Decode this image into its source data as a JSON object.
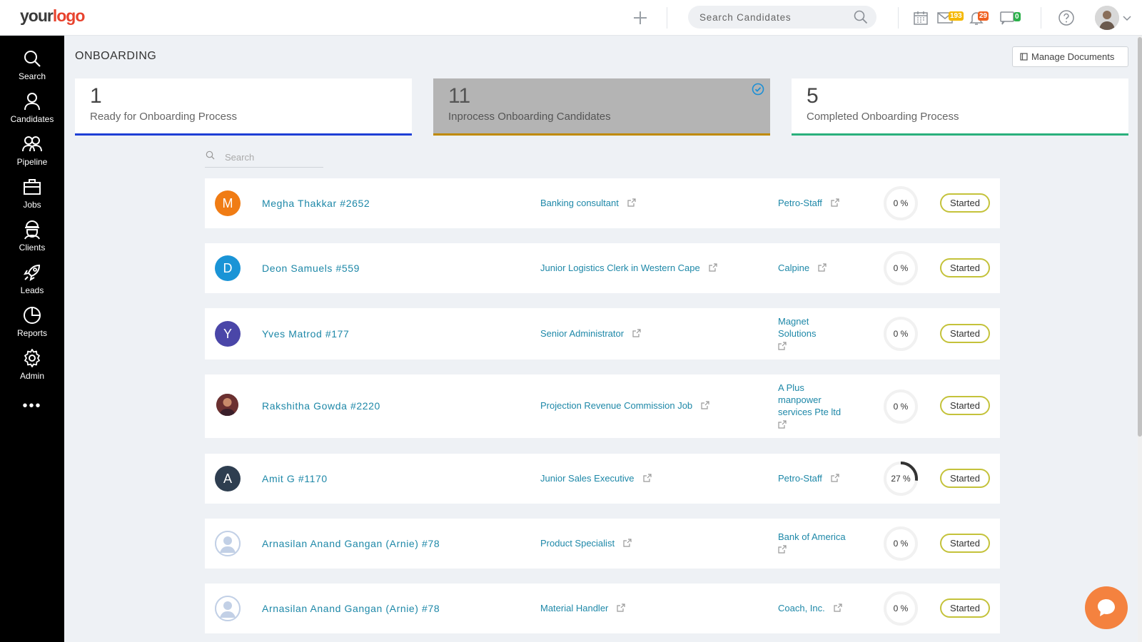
{
  "logo": {
    "part1": "your",
    "part2": "logo"
  },
  "topbar": {
    "search_placeholder": "Search Candidates",
    "mail_count": "193",
    "notification_count": "29",
    "chat_count": "0"
  },
  "sidebar": {
    "items": [
      {
        "label": "Search",
        "icon": "search-icon"
      },
      {
        "label": "Candidates",
        "icon": "user-icon"
      },
      {
        "label": "Pipeline",
        "icon": "users-icon"
      },
      {
        "label": "Jobs",
        "icon": "briefcase-icon"
      },
      {
        "label": "Clients",
        "icon": "client-icon"
      },
      {
        "label": "Leads",
        "icon": "rocket-icon"
      },
      {
        "label": "Reports",
        "icon": "pie-chart-icon"
      },
      {
        "label": "Admin",
        "icon": "gear-icon"
      }
    ],
    "more": "•••"
  },
  "page": {
    "title": "ONBOARDING",
    "manage_documents": "Manage Documents"
  },
  "stats": [
    {
      "count": "1",
      "label": "Ready for Onboarding Process",
      "color": "#1e3fd6"
    },
    {
      "count": "11",
      "label": "Inprocess Onboarding Candidates",
      "color": "#c08a00"
    },
    {
      "count": "5",
      "label": "Completed Onboarding Process",
      "color": "#2ab07c"
    }
  ],
  "list": {
    "search_placeholder": "Search",
    "rows": [
      {
        "initial": "M",
        "avatar_color": "#f07c14",
        "name": "Megha Thakkar #2652",
        "job": "Banking consultant",
        "client": "Petro-Staff",
        "progress": 0,
        "progress_label": "0 %",
        "status": "Started"
      },
      {
        "initial": "D",
        "avatar_color": "#1a94d6",
        "name": "Deon Samuels #559",
        "job": "Junior Logistics Clerk in Western Cape",
        "client": "Calpine",
        "progress": 0,
        "progress_label": "0 %",
        "status": "Started"
      },
      {
        "initial": "Y",
        "avatar_color": "#4a46a8",
        "name": "Yves Matrod #177",
        "job": "Senior Administrator",
        "client": "Magnet Solutions",
        "progress": 0,
        "progress_label": "0 %",
        "status": "Started"
      },
      {
        "initial": "",
        "avatar_color": "#5a2a2a",
        "name": "Rakshitha Gowda #2220",
        "job": "Projection Revenue Commission Job",
        "client": "A Plus manpower services Pte ltd",
        "progress": 0,
        "progress_label": "0 %",
        "status": "Started"
      },
      {
        "initial": "A",
        "avatar_color": "#2e3e50",
        "name": "Amit G #1170",
        "job": "Junior Sales Executive",
        "client": "Petro-Staff",
        "progress": 27,
        "progress_label": "27 %",
        "status": "Started"
      },
      {
        "initial": "",
        "avatar_color": "#c7d5ea",
        "name": "Arnasilan Anand Gangan (Arnie) #78",
        "job": "Product Specialist",
        "client": "Bank of America",
        "progress": 0,
        "progress_label": "0 %",
        "status": "Started"
      },
      {
        "initial": "",
        "avatar_color": "#c7d5ea",
        "name": "Arnasilan Anand Gangan (Arnie) #78",
        "job": "Material Handler",
        "client": "Coach, Inc.",
        "progress": 0,
        "progress_label": "0 %",
        "status": "Started"
      }
    ]
  }
}
